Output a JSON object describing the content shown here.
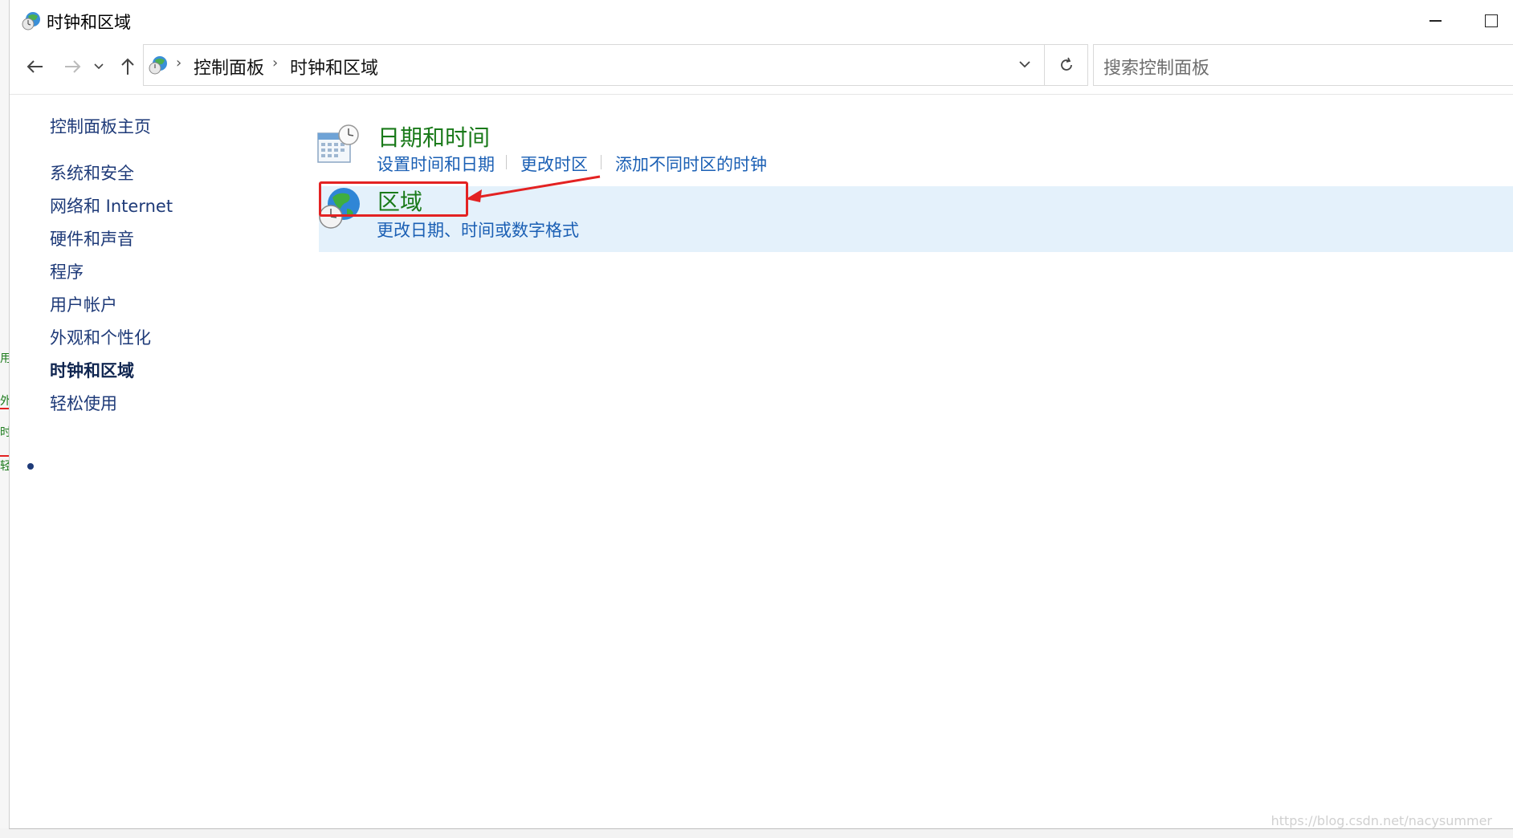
{
  "window": {
    "title": "时钟和区域",
    "icon": "clock-globe-icon"
  },
  "nav": {
    "back_icon": "back-arrow-icon",
    "forward_icon": "forward-arrow-icon",
    "recent_icon": "chevron-down-icon",
    "up_icon": "up-arrow-icon",
    "breadcrumb": [
      "控制面板",
      "时钟和区域"
    ],
    "search_placeholder": "搜索控制面板",
    "refresh_icon": "refresh-icon"
  },
  "sidebar": {
    "home": "控制面板主页",
    "items": [
      {
        "label": "系统和安全",
        "active": false
      },
      {
        "label": "网络和 Internet",
        "active": false
      },
      {
        "label": "硬件和声音",
        "active": false
      },
      {
        "label": "程序",
        "active": false
      },
      {
        "label": "用户帐户",
        "active": false
      },
      {
        "label": "外观和个性化",
        "active": false
      },
      {
        "label": "时钟和区域",
        "active": true
      },
      {
        "label": "轻松使用",
        "active": false
      }
    ]
  },
  "main": {
    "sections": [
      {
        "title": "日期和时间",
        "icon": "calendar-clock-icon",
        "links": [
          "设置时间和日期",
          "更改时区",
          "添加不同时区的时钟"
        ]
      },
      {
        "title": "区域",
        "icon": "globe-clock-icon",
        "links": [
          "更改日期、时间或数字格式"
        ],
        "highlighted": true
      }
    ]
  },
  "colors": {
    "section_title": "#1a7a1a",
    "link": "#1a5fb4",
    "sidebar_text": "#1e3a78",
    "highlight_bg": "#e4f1fb",
    "annotation_red": "#e32222"
  },
  "edge_fragments": [
    "用",
    "外",
    "时",
    "轻"
  ],
  "watermark": "https://blog.csdn.net/nacysummer"
}
